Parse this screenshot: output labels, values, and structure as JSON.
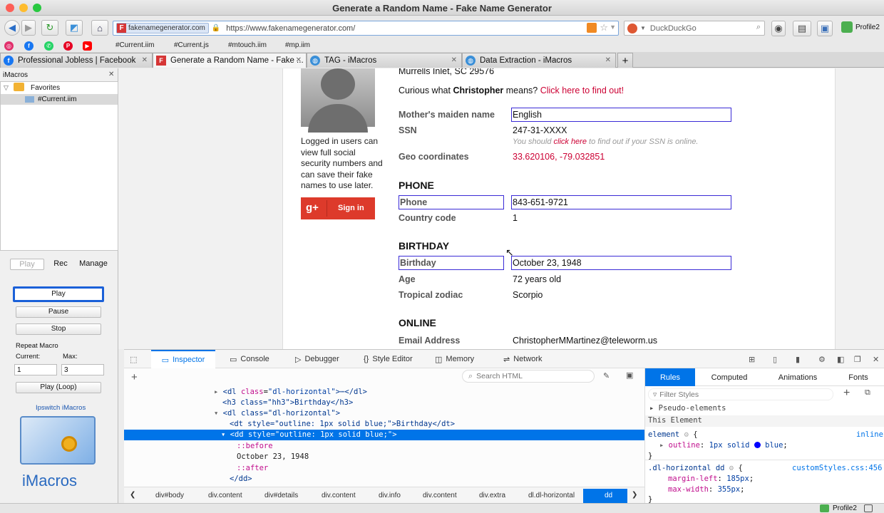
{
  "window": {
    "title": "Generate a Random Name - Fake Name Generator"
  },
  "navbar": {
    "site_label": "fakenamegenerator.com",
    "url": "https://www.fakenamegenerator.com/",
    "search_placeholder": "DuckDuckGo",
    "profile": "Profile2"
  },
  "bookmarks": [
    "#Current.iim",
    "#Current.js",
    "#mtouch.iim",
    "#mp.iim"
  ],
  "tabs": [
    {
      "label": "Professional Jobless | Facebook"
    },
    {
      "label": "Generate a Random Name - Fake ..."
    },
    {
      "label": "TAG - iMacros"
    },
    {
      "label": "Data Extraction - iMacros"
    }
  ],
  "sidebar": {
    "header": "iMacros",
    "folder": "Favorites",
    "file": "#Current.iim",
    "modes": [
      "Play",
      "Rec",
      "Manage"
    ],
    "play": "Play",
    "pause": "Pause",
    "stop": "Stop",
    "repeat_label": "Repeat Macro",
    "current_label": "Current:",
    "max_label": "Max:",
    "current_value": "1",
    "max_value": "3",
    "play_loop": "Play (Loop)",
    "brand_link": "Ipswitch iMacros",
    "logo_text": "iMacros"
  },
  "page": {
    "address_tail": "Murrells Inlet, SC 29576",
    "login_note": [
      "Logged in users can",
      "view full social",
      "security numbers and",
      "can save their fake",
      "names to use later."
    ],
    "signin": "Sign in",
    "curious_pre": "Curious what ",
    "curious_name": "Christopher",
    "curious_mid": " means? ",
    "curious_link": "Click here to find out!",
    "fields": {
      "maiden_label": "Mother's maiden name",
      "maiden_value": "English",
      "ssn_label": "SSN",
      "ssn_value": "247-31-XXXX",
      "ssn_note_pre": "You should ",
      "ssn_note_link": "click here",
      "ssn_note_post": " to find out if your SSN is online.",
      "geo_label": "Geo coordinates",
      "geo_value": "33.620106, -79.032851",
      "phone_section": "PHONE",
      "phone_label": "Phone",
      "phone_value": "843-651-9721",
      "cc_label": "Country code",
      "cc_value": "1",
      "birthday_section": "BIRTHDAY",
      "birthday_label": "Birthday",
      "birthday_value": "October 23, 1948",
      "age_label": "Age",
      "age_value": "72 years old",
      "zodiac_label": "Tropical zodiac",
      "zodiac_value": "Scorpio",
      "online_section": "ONLINE",
      "email_label": "Email Address",
      "email_value": "ChristopherMMartinez@teleworm.us"
    }
  },
  "devtools": {
    "tabs": [
      "Inspector",
      "Console",
      "Debugger",
      "Style Editor",
      "Memory",
      "Network"
    ],
    "search_placeholder": "Search HTML",
    "tree": [
      {
        "open": "<",
        "tag": "dl",
        "attr": "class",
        "aval": "\"dl-horizontal\"",
        "tail": ">⋯</dl>"
      },
      {
        "text": "<h3 class=\"hh3\">Birthday</h3>"
      },
      {
        "text": "<dl class=\"dl-horizontal\">"
      },
      {
        "text": "<dt style=\"outline: 1px solid blue;\">Birthday</dt>"
      },
      {
        "text": "<dd style=\"outline: 1px solid blue;\">"
      },
      {
        "text": "::before"
      },
      {
        "text": "October 23, 1948"
      },
      {
        "text": "::after"
      },
      {
        "text": "</dd>"
      }
    ],
    "breadcrumbs": [
      "div#body",
      "div.content",
      "div#details",
      "div.content",
      "div.info",
      "div.content",
      "div.extra",
      "dl.dl-horizontal",
      "dd"
    ],
    "rules_tabs": [
      "Rules",
      "Computed",
      "Animations",
      "Fonts"
    ],
    "filter_placeholder": "Filter Styles",
    "pseudo_elements": "Pseudo-elements",
    "this_element": "This Element",
    "rule1_selector": "element",
    "rule1_source": "inline",
    "rule1_prop": "outline",
    "rule1_value_pre": "1px solid ",
    "rule1_value_color": "blue",
    "rule2_selector": ".dl-horizontal dd",
    "rule2_source": "customStyles.css:456",
    "rule2_prop1": "margin-left",
    "rule2_val1": "185px",
    "rule2_prop2": "max-width",
    "rule2_val2": "355px"
  },
  "statusbar": {
    "profile": "Profile2"
  },
  "colors": {
    "accent": "#0074e8",
    "link": "#cc0033",
    "outline": "#3a2bd6",
    "selected": "#0074e8"
  }
}
